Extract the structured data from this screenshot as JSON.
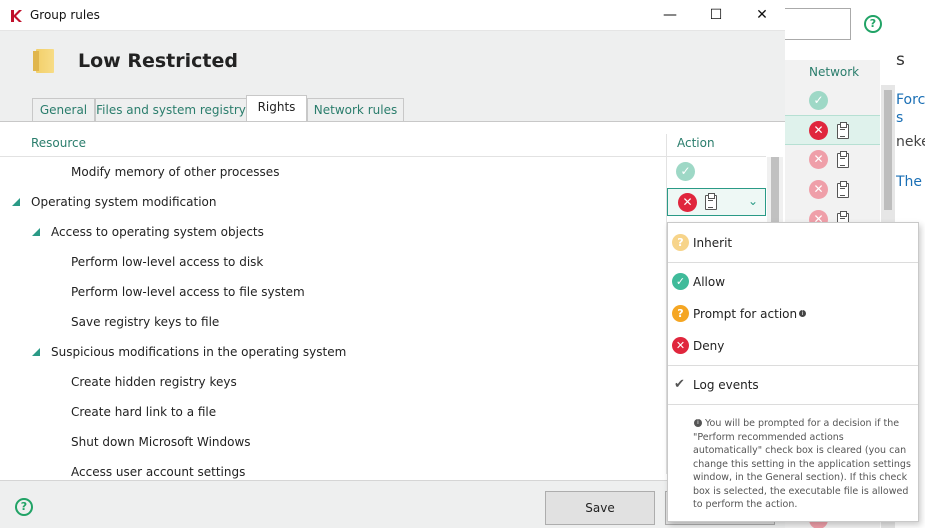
{
  "window": {
    "title": "Group rules",
    "minimize": "—",
    "maximize": "☐",
    "close": "✕"
  },
  "header": {
    "title": "Low Restricted"
  },
  "tabs": [
    {
      "label": "General"
    },
    {
      "label": "Files and system registry"
    },
    {
      "label": "Rights",
      "active": true
    },
    {
      "label": "Network rules"
    }
  ],
  "columns": {
    "resource": "Resource",
    "action": "Action"
  },
  "rows": [
    {
      "label": "Modify memory of other processes",
      "level": 2,
      "action": "allow"
    },
    {
      "label": "Operating system modification",
      "level": 0,
      "expanded": true,
      "action": "deny-log",
      "selected": true
    },
    {
      "label": "Access to operating system objects",
      "level": 1,
      "expanded": true
    },
    {
      "label": "Perform low-level access to disk",
      "level": 2
    },
    {
      "label": "Perform low-level access to file system",
      "level": 2
    },
    {
      "label": "Save registry keys to file",
      "level": 2
    },
    {
      "label": "Suspicious modifications in the operating system",
      "level": 1,
      "expanded": true
    },
    {
      "label": "Create hidden registry keys",
      "level": 2
    },
    {
      "label": "Create hard link to a file",
      "level": 2
    },
    {
      "label": "Shut down Microsoft Windows",
      "level": 2
    },
    {
      "label": "Access user account settings",
      "level": 2
    }
  ],
  "menu": {
    "inherit": "Inherit",
    "allow": "Allow",
    "prompt": "Prompt for action",
    "deny": "Deny",
    "log_events": "Log events",
    "note": "You will be prompted for a decision if the \"Perform recommended actions automatically\" check box is cleared (you can change this setting in the application settings window, in the General section). If this check box is selected, the executable file is allowed to perform the action."
  },
  "footer": {
    "save": "Save",
    "help": "?"
  },
  "background": {
    "network_header": "Network",
    "help": "?",
    "partial_text": [
      "Forc",
      "s",
      "neke",
      "The c",
      "s"
    ]
  },
  "colors": {
    "accent": "#2a7d6c",
    "allow": "#3fbb9a",
    "deny": "#e0263d",
    "prompt": "#f5a623",
    "link": "#1a6fb5"
  }
}
